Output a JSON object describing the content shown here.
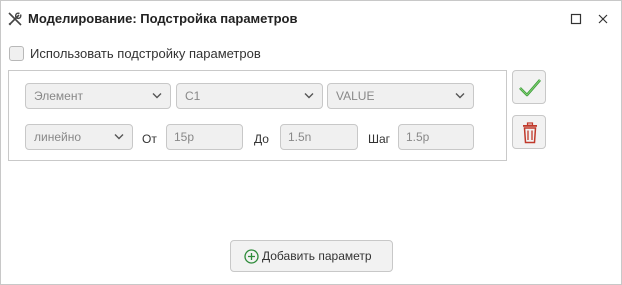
{
  "window": {
    "title": "Моделирование: Подстройка параметров"
  },
  "options": {
    "use_tuning_label": "Использовать подстройку параметров",
    "use_tuning_checked": false
  },
  "parameter": {
    "element_select": "Элемент",
    "component_select": "C1",
    "property_select": "VALUE",
    "scale_select": "линейно",
    "from_label": "От",
    "from_value": "15p",
    "to_label": "До",
    "to_value": "1.5n",
    "step_label": "Шаг",
    "step_value": "1.5p"
  },
  "actions": {
    "add_parameter_label": "Добавить параметр"
  },
  "colors": {
    "accept_green": "#3a9a3a",
    "delete_red": "#c0392b",
    "add_green": "#2e8b3a"
  }
}
